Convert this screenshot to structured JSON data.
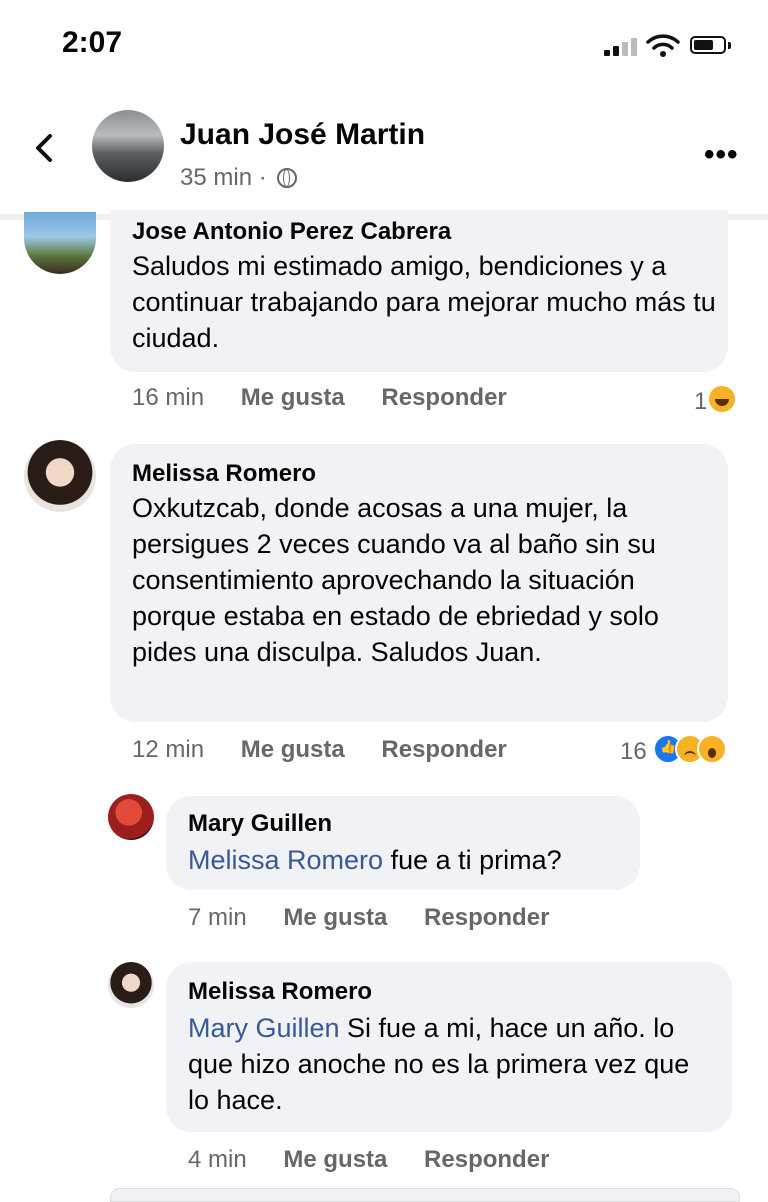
{
  "status_bar": {
    "time": "2:07"
  },
  "post_header": {
    "author": "Juan José Martin",
    "time": "35 min",
    "separator": "·",
    "more_label": "•••"
  },
  "comments": [
    {
      "author": "Jose Antonio Perez Cabrera",
      "text": "Saludos mi estimado amigo, bendiciones y a continuar trabajando para mejorar mucho más tu ciudad.",
      "time": "16 min",
      "like_label": "Me gusta",
      "reply_label": "Responder",
      "reaction_count": "1",
      "reactions": [
        "haha"
      ]
    },
    {
      "author": "Melissa Romero",
      "text": "Oxkutzcab, donde acosas a una mujer, la persigues 2 veces cuando va al baño sin su consentimiento aprovechando la situación porque estaba en estado de ebriedad y solo pides una disculpa. Saludos Juan.",
      "time": "12 min",
      "like_label": "Me gusta",
      "reply_label": "Responder",
      "reaction_count": "16",
      "reactions": [
        "like",
        "sad",
        "wow"
      ]
    }
  ],
  "replies": [
    {
      "author": "Mary Guillen",
      "mention": "Melissa Romero",
      "text": " fue a ti prima?",
      "time": "7 min",
      "like_label": "Me gusta",
      "reply_label": "Responder"
    },
    {
      "author": "Melissa Romero",
      "mention": "Mary Guillen",
      "text": " Si fue a mi, hace un año. lo que hizo anoche no es la primera vez que lo hace.",
      "time": "4 min",
      "like_label": "Me gusta",
      "reply_label": "Responder"
    }
  ]
}
